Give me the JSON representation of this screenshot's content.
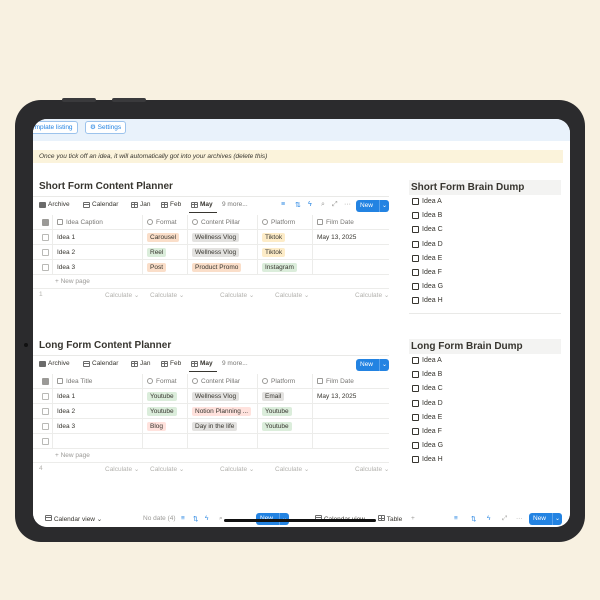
{
  "top": {
    "template_label": "emplate listing",
    "settings_label": "⚙ Settings"
  },
  "callout": "Once you tick off an idea, it will automatically got into your archives (delete this)",
  "short_planner": {
    "title": "Short Form Content Planner",
    "tabs": [
      "Archive",
      "Calendar",
      "Jan",
      "Feb",
      "May",
      "9 more..."
    ],
    "new_label": "New",
    "columns": [
      "Idea Caption",
      "Format",
      "Content Pillar",
      "Platform",
      "Film Date"
    ],
    "rows": [
      {
        "name": "Idea 1",
        "format": "Carousel",
        "pillar": "Wellness Vlog",
        "platform": "Tiktok",
        "film_date": "May 13, 2025"
      },
      {
        "name": "Idea 2",
        "format": "Reel",
        "pillar": "Wellness Vlog",
        "platform": "Tiktok",
        "film_date": ""
      },
      {
        "name": "Idea 3",
        "format": "Post",
        "pillar": "Product Promo",
        "platform": "Instagram",
        "film_date": ""
      }
    ],
    "new_page": "+  New page",
    "count": "1",
    "calculate": "Calculate ⌄"
  },
  "long_planner": {
    "title": "Long Form Content Planner",
    "tabs": [
      "Archive",
      "Calendar",
      "Jan",
      "Feb",
      "May",
      "9 more..."
    ],
    "new_label": "New",
    "columns": [
      "Idea Title",
      "Format",
      "Content Pillar",
      "Platform",
      "Film Date"
    ],
    "rows": [
      {
        "name": "Idea 1",
        "format": "Youtube",
        "pillar": "Wellness Vlog",
        "platform": "Email",
        "film_date": "May 13, 2025"
      },
      {
        "name": "Idea 2",
        "format": "Youtube",
        "pillar": "Notion Planning ...",
        "platform": "Youtube",
        "film_date": ""
      },
      {
        "name": "Idea 3",
        "format": "Blog",
        "pillar": "Day in the life",
        "platform": "Youtube",
        "film_date": ""
      }
    ],
    "new_page": "+  New page",
    "count": "4",
    "calculate": "Calculate ⌄"
  },
  "short_dump": {
    "title": "Short Form Brain Dump",
    "items": [
      "Idea A",
      "Idea B",
      "Idea C",
      "Idea D",
      "Idea E",
      "Idea F",
      "Idea G",
      "Idea H"
    ]
  },
  "long_dump": {
    "title": "Long Form Brain Dump",
    "items": [
      "Idea A",
      "Idea B",
      "Idea C",
      "Idea D",
      "Idea E",
      "Idea F",
      "Idea G",
      "Idea H"
    ]
  },
  "bottom": {
    "calendar_view": "Calendar view ⌄",
    "no_date": "No date (4)",
    "new_label": "New",
    "calendar_view_tab": "Calendar view",
    "table_tab": "Table",
    "plus": "+",
    "new_label_right": "New"
  },
  "tag_colors": {
    "Carousel": "#fadec9",
    "Reel": "#dbeddb",
    "Post": "#fadec9",
    "Youtube": "#dbeddb",
    "Blog": "#ffe2dd",
    "Wellness Vlog": "#e3e2e0",
    "Product Promo": "#fadec9",
    "Notion Planning ...": "#ffe2dd",
    "Day in the life": "#e3e2e0",
    "Tiktok": "#fdecc8",
    "Instagram": "#dbeddb",
    "Email": "#e3e2e0"
  }
}
